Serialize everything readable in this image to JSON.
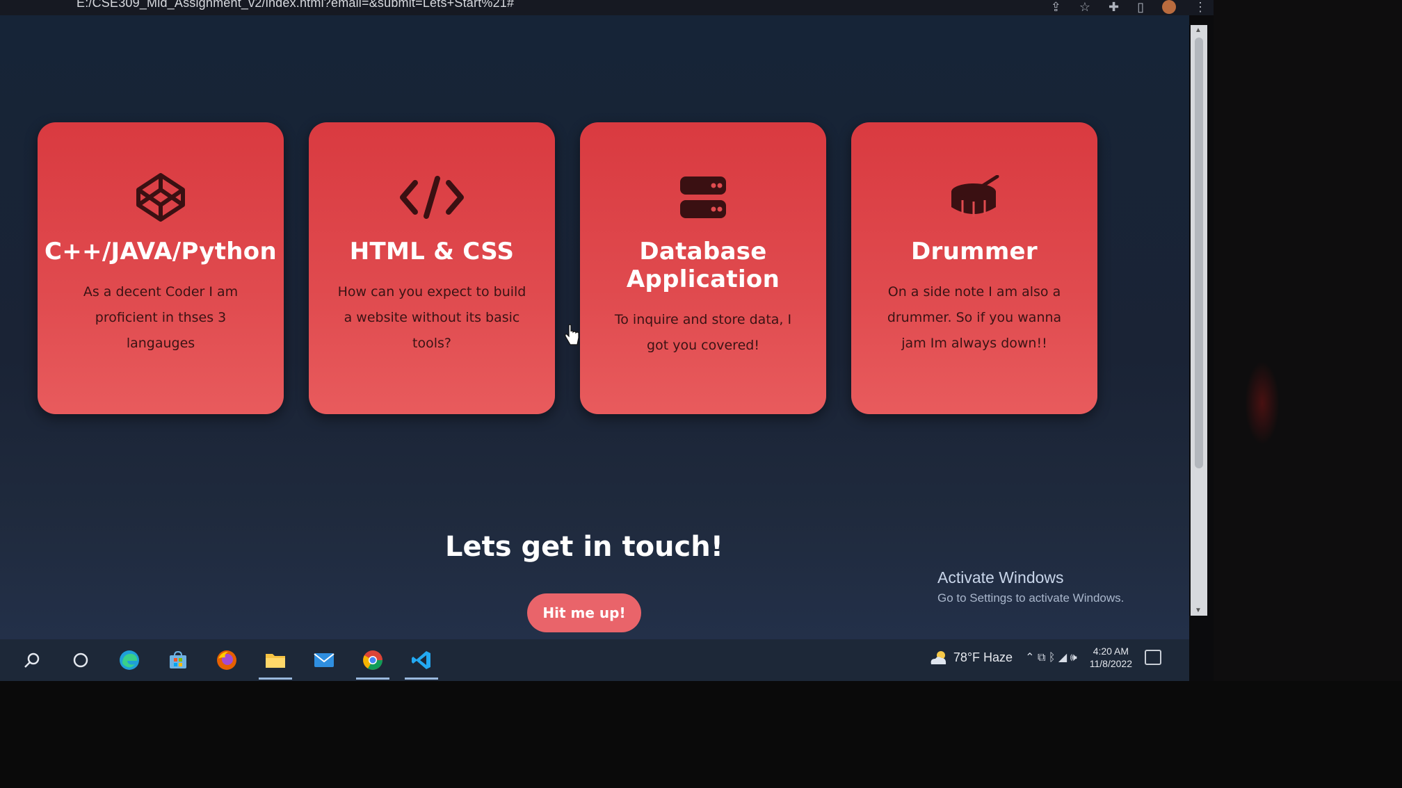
{
  "browser": {
    "address": "E:/CSE309_Mid_Assignment_v2/index.html?email=&submit=Lets+Start%21#",
    "icons": [
      "share-icon",
      "star-icon",
      "extensions-icon",
      "sidebar-icon",
      "profile-icon",
      "menu-icon"
    ]
  },
  "cards": [
    {
      "icon": "codepen-icon",
      "title": "C++/JAVA/Python",
      "text": "As a decent Coder I am proficient in thses 3 langauges"
    },
    {
      "icon": "code-icon",
      "title": "HTML & CSS",
      "text": "How can you expect to build a website without its basic tools?"
    },
    {
      "icon": "server-icon",
      "title": "Database Application",
      "text": "To inquire and store data, I got you covered!"
    },
    {
      "icon": "drum-icon",
      "title": "Drummer",
      "text": "On a side note I am also a drummer. So if you wanna jam Im always down!!"
    }
  ],
  "contact": {
    "heading": "Lets get in touch!",
    "button": "Hit me up!"
  },
  "watermark": {
    "title": "Activate Windows",
    "subtitle": "Go to Settings to activate Windows."
  },
  "taskbar": {
    "items": [
      "search-icon",
      "cortana-icon",
      "edge-icon",
      "store-icon",
      "firefox-icon",
      "file-explorer-icon",
      "mail-icon",
      "chrome-icon",
      "vscode-icon"
    ],
    "weather": "78°F  Haze",
    "time": "4:20 AM",
    "date": "11/8/2022"
  },
  "colors": {
    "card": "#e04b4f",
    "background": "#1a2335",
    "button": "#e9646a"
  }
}
